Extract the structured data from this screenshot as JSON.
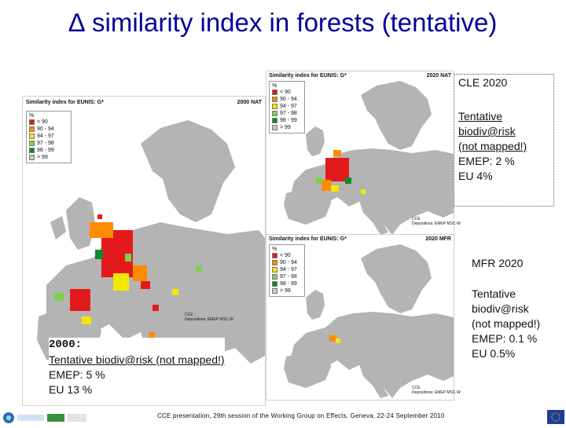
{
  "title": "∆ similarity index in forests (tentative)",
  "colors": {
    "title": "#00009c",
    "land": "#b4b4b4",
    "sea": "#ffffff",
    "red": "#e31a1c",
    "orange": "#ff8c00",
    "yellow": "#f2e900",
    "light_green": "#7cd34a",
    "dark_green": "#0b8a2a",
    "neutral": "#c8c8c8"
  },
  "legend_items": [
    "< 90",
    "90 - 94",
    "94 - 97",
    "97 - 98",
    "98 - 99",
    "> 99"
  ],
  "legend_colors": [
    "#e31a1c",
    "#ff8c00",
    "#f2e900",
    "#7cd34a",
    "#0b8a2a",
    "#c8c8c8"
  ],
  "map_large": {
    "title": "Similarity index for EUNIS: G*",
    "code": "2000 NAT",
    "legend_unit": "%",
    "credit": "CCE\nDepositions: EMEP MSC-W"
  },
  "map_top": {
    "title": "Similarity index for EUNIS: G*",
    "code": "2020 NAT",
    "legend_unit": "%",
    "credit": "CCE\nDepositions: EMEP MSC-W"
  },
  "map_bottom": {
    "title": "Similarity index for EUNIS: G*",
    "code": "2020 MFR",
    "legend_unit": "%",
    "credit": "CCE\nDepositions: EMEP MSC-W"
  },
  "note_2000": {
    "heading": "2000:",
    "line1": "Tentative biodiv@risk (not mapped!)",
    "line2": "EMEP: 5 %",
    "line3": "EU 13 %"
  },
  "note_cle": {
    "heading": "CLE 2020",
    "line1": "Tentative",
    "line2": "biodiv@risk",
    "line3": "(not mapped!)",
    "line4": "EMEP: 2 %",
    "line5": "EU 4%"
  },
  "note_mfr": {
    "heading": "MFR 2020",
    "line1": "Tentative",
    "line2": "biodiv@risk",
    "line3": "(not mapped!)",
    "line4": "EMEP: 0.1 %",
    "line5": "EU 0.5%"
  },
  "footer": "CCE presentation, 29th session of the Working Group on Effects, Geneva, 22-24 September 2010",
  "logos": {
    "left": "CCE / RIAS",
    "right": "EU flag"
  }
}
